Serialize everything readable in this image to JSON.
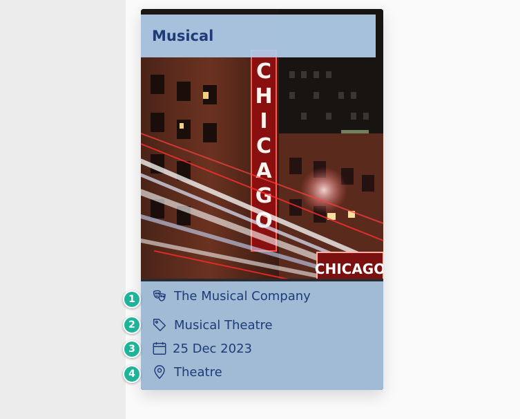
{
  "card": {
    "title": "Musical",
    "image_alt": "Chicago theatre marquee at night"
  },
  "details": [
    {
      "icon": "theatre-masks-icon",
      "text": "The Musical Company"
    },
    {
      "icon": "tag-icon",
      "text": "Musical Theatre"
    },
    {
      "icon": "calendar-icon",
      "text": "25 Dec 2023"
    },
    {
      "icon": "map-pin-icon",
      "text": "Theatre"
    }
  ],
  "badges": [
    "1",
    "2",
    "3",
    "4"
  ],
  "photo_sign": {
    "vertical": "CHICAGO",
    "marquee": "CHICAGO"
  },
  "colors": {
    "accent": "#1f3a78",
    "panel": "#b2cfec",
    "badge": "#1fb39a"
  }
}
